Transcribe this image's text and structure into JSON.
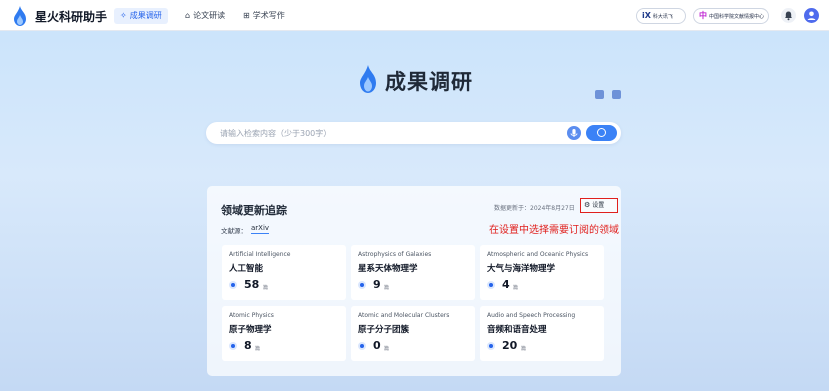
{
  "app": {
    "name": "星火科研助手"
  },
  "nav": {
    "tabs": [
      {
        "label": "成果调研",
        "icon": "sparkle-icon",
        "active": true
      },
      {
        "label": "论文研读",
        "icon": "house-icon",
        "active": false
      },
      {
        "label": "学术写作",
        "icon": "grid-icon",
        "active": false
      }
    ]
  },
  "partners": [
    {
      "mark": "iX",
      "label": "科大讯飞"
    },
    {
      "mark": "中",
      "label": "中国科学院文献情报中心"
    }
  ],
  "hero": {
    "title": "成果调研"
  },
  "search": {
    "placeholder": "请输入检索内容（少于300字）"
  },
  "panel": {
    "title": "领域更新追踪",
    "update_info": "数据更新于：2024年8月27日",
    "settings_label": "设置",
    "source_label": "文献源：",
    "source_value": "arXiv",
    "cards": [
      {
        "en": "Artificial Intelligence",
        "cn": "人工智能",
        "count": "58",
        "unit": "篇"
      },
      {
        "en": "Astrophysics of Galaxies",
        "cn": "星系天体物理学",
        "count": "9",
        "unit": "篇"
      },
      {
        "en": "Atmospheric and Oceanic Physics",
        "cn": "大气与海洋物理学",
        "count": "4",
        "unit": "篇"
      },
      {
        "en": "Atomic Physics",
        "cn": "原子物理学",
        "count": "8",
        "unit": "篇"
      },
      {
        "en": "Atomic and Molecular Clusters",
        "cn": "原子分子团簇",
        "count": "0",
        "unit": "篇"
      },
      {
        "en": "Audio and Speech Processing",
        "cn": "音频和语音处理",
        "count": "20",
        "unit": "篇"
      }
    ]
  },
  "annotation": {
    "text": "在设置中选择需要订阅的领域"
  },
  "colors": {
    "accent": "#3b82f6",
    "highlight": "#e0201d"
  }
}
